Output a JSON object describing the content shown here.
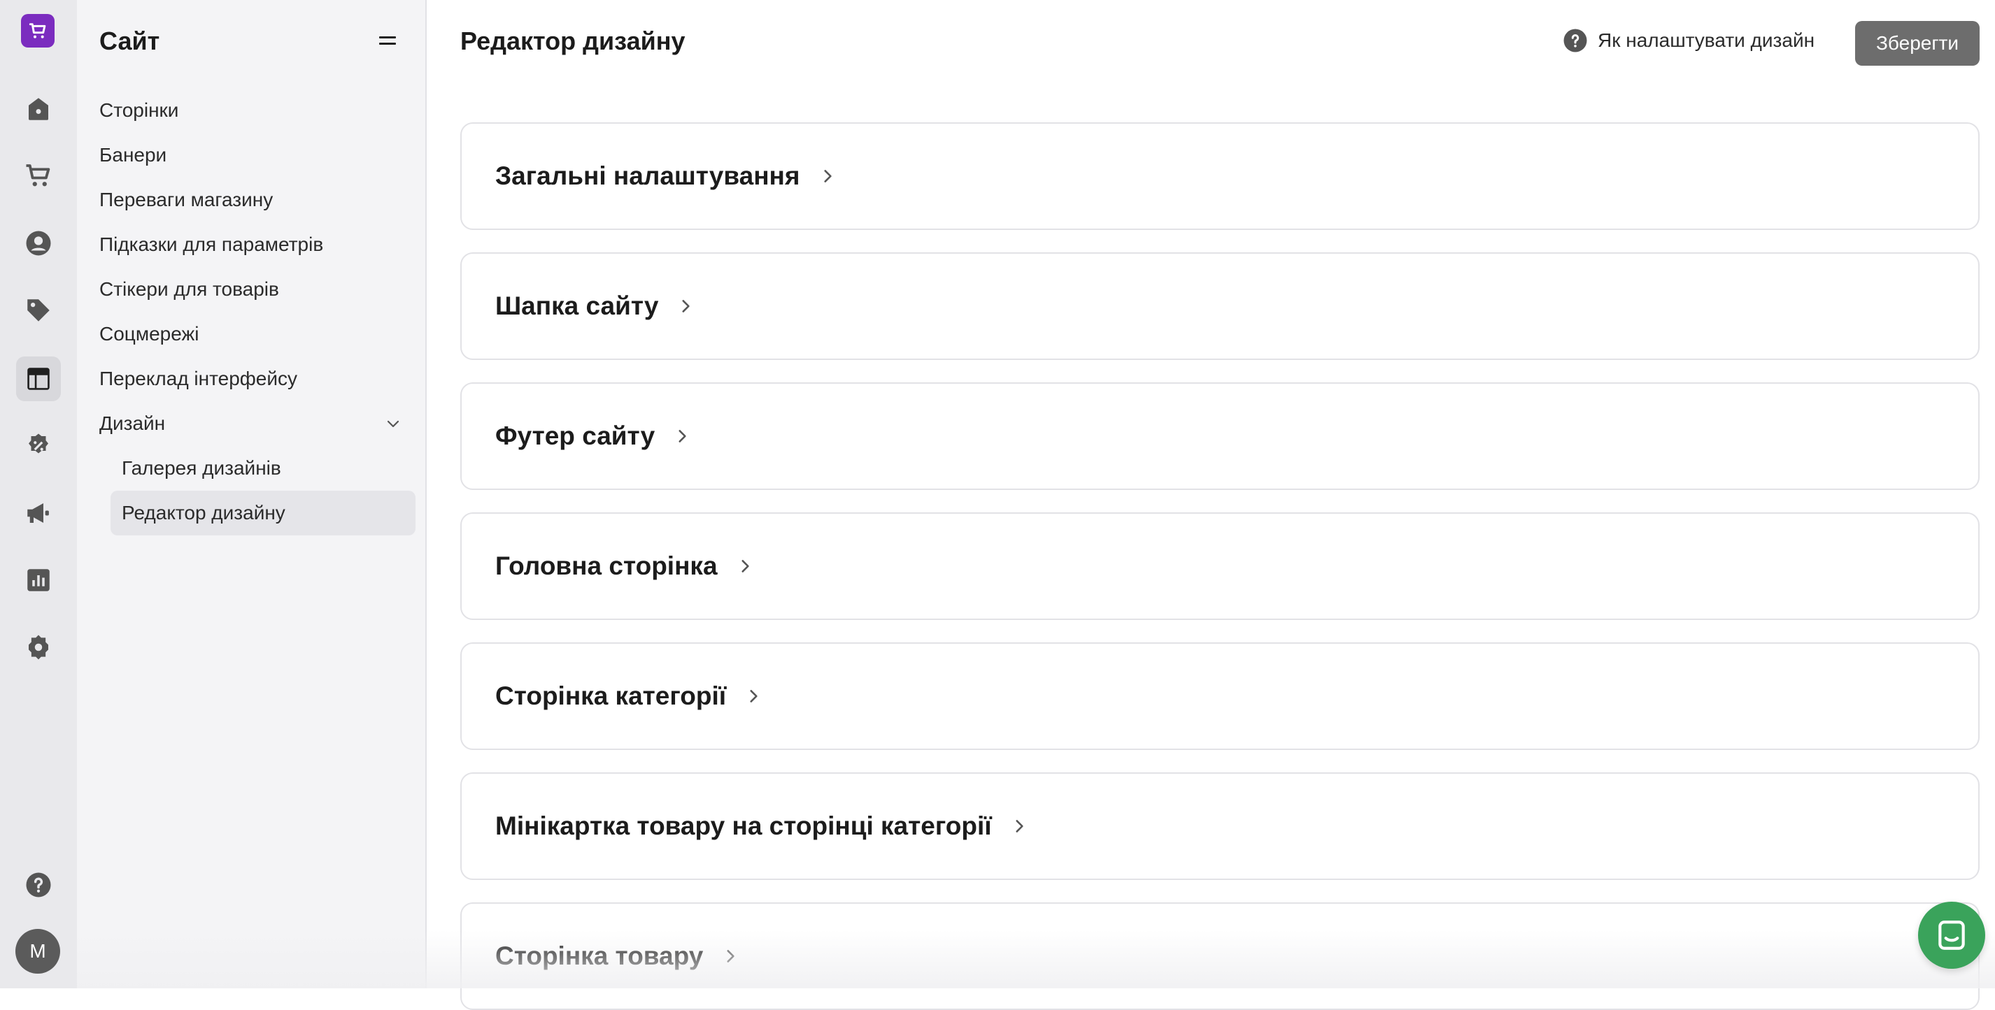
{
  "rail": {
    "items": [
      {
        "name": "home-icon"
      },
      {
        "name": "cart-icon"
      },
      {
        "name": "user-icon"
      },
      {
        "name": "tag-icon"
      },
      {
        "name": "layout-icon",
        "active": true
      },
      {
        "name": "discount-icon"
      },
      {
        "name": "megaphone-icon"
      },
      {
        "name": "chart-icon"
      },
      {
        "name": "settings-icon"
      },
      {
        "name": "help-icon"
      }
    ],
    "avatar_letter": "M",
    "brand_color": "#7b2cbf"
  },
  "sidebar": {
    "title": "Сайт",
    "items": [
      {
        "label": "Сторінки"
      },
      {
        "label": "Банери"
      },
      {
        "label": "Переваги магазину"
      },
      {
        "label": "Підказки для параметрів"
      },
      {
        "label": "Стікери для товарів"
      },
      {
        "label": "Соцмережі"
      },
      {
        "label": "Переклад інтерфейсу"
      },
      {
        "label": "Дизайн"
      }
    ],
    "sub_items": [
      {
        "label": "Галерея дизайнів"
      },
      {
        "label": "Редактор дизайну",
        "active": true
      }
    ]
  },
  "header": {
    "title": "Редактор дизайну",
    "help_label": "Як налаштувати дизайн",
    "save_label": "Зберегти"
  },
  "sections": [
    {
      "label": "Загальні налаштування"
    },
    {
      "label": "Шапка сайту"
    },
    {
      "label": "Футер сайту"
    },
    {
      "label": "Головна сторінка"
    },
    {
      "label": "Сторінка категорії"
    },
    {
      "label": "Мінікартка товару на сторінці категорії"
    },
    {
      "label": "Сторінка товару"
    }
  ],
  "chat": {
    "color": "#3aa35b"
  }
}
